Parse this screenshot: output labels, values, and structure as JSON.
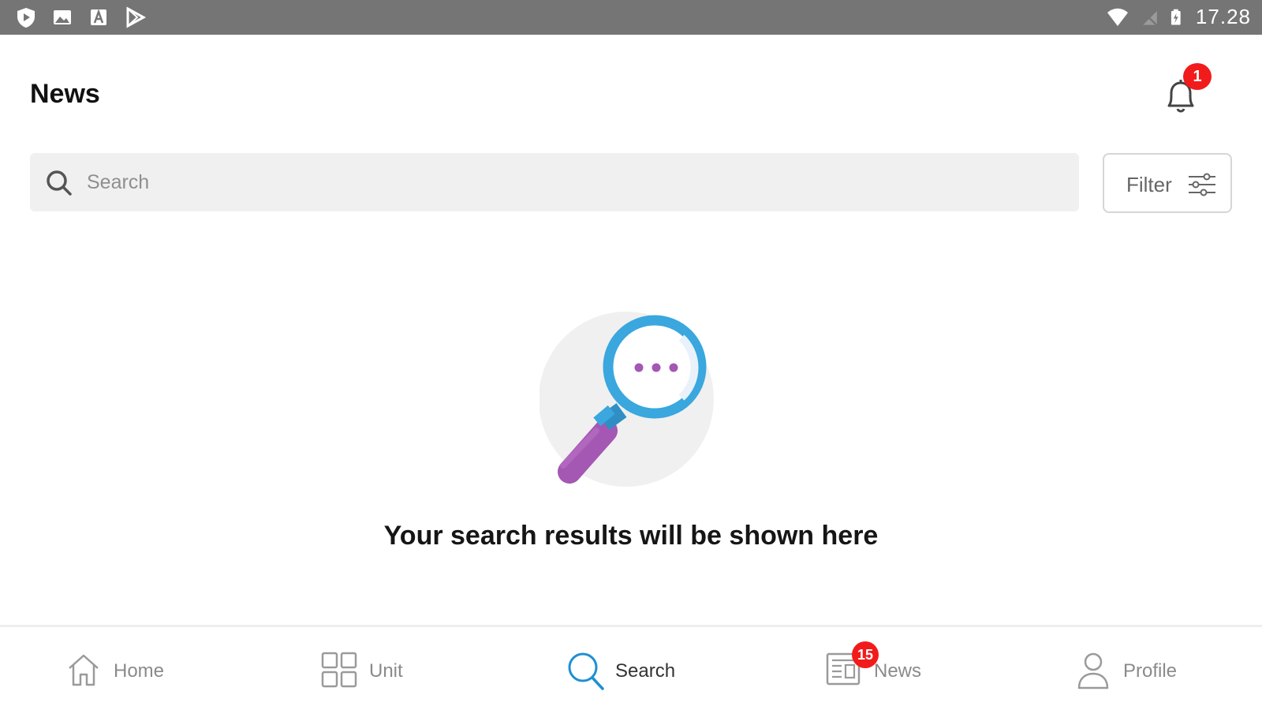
{
  "status_bar": {
    "time": "17.28",
    "left_icons": [
      "shield-icon",
      "image-icon",
      "a-box-icon",
      "play-store-icon"
    ],
    "right_icons": [
      "wifi-icon",
      "no-signal-icon",
      "battery-charging-icon"
    ]
  },
  "header": {
    "title": "News",
    "notification_count": "1"
  },
  "search": {
    "placeholder": "Search",
    "value": ""
  },
  "filter": {
    "label": "Filter"
  },
  "empty_state": {
    "message": "Your search results will be shown here"
  },
  "bottom_nav": {
    "items": [
      {
        "label": "Home",
        "icon": "home-icon",
        "active": false
      },
      {
        "label": "Unit",
        "icon": "grid-icon",
        "active": false
      },
      {
        "label": "Search",
        "icon": "search-icon",
        "active": true
      },
      {
        "label": "News",
        "icon": "newspaper-icon",
        "active": false,
        "badge": "15"
      },
      {
        "label": "Profile",
        "icon": "person-icon",
        "active": false
      }
    ]
  },
  "colors": {
    "status_bar": "#757575",
    "accent": "#1d8fd6",
    "badge": "#f21b1b",
    "search_bg": "#f0f0f0",
    "illustration_ring": "#3aa7de",
    "illustration_handle": "#a457b3"
  }
}
